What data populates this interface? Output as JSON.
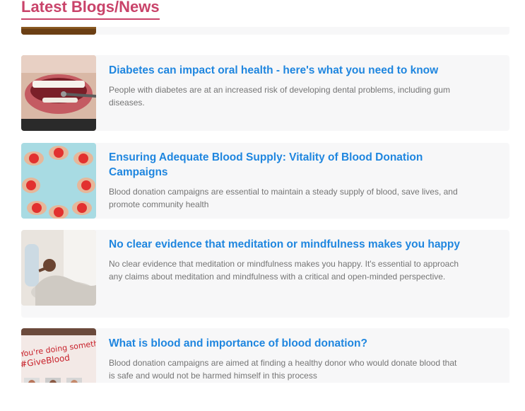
{
  "section": {
    "title": "Latest Blogs/News"
  },
  "posts": [
    {
      "title": "Diabetes can impact oral health - here's what you need to know",
      "excerpt": "People with diabetes are at an increased risk of developing dental problems, including gum diseases.",
      "image_icon": "dental-checkup-image"
    },
    {
      "title": "Ensuring Adequate Blood Supply: Vitality of Blood Donation Campaigns",
      "excerpt": "Blood donation campaigns are essential to maintain a steady supply of blood, save lives, and promote community health",
      "image_icon": "hands-holding-hearts-image"
    },
    {
      "title": "No clear evidence that meditation or mindfulness makes you happy",
      "excerpt": "No clear evidence that meditation or mindfulness makes you happy. It's essential to approach any claims about meditation and mindfulness with a critical and open-minded perspective.",
      "image_icon": "meditation-pose-image"
    },
    {
      "title": "What is blood and importance of blood donation?",
      "excerpt": "Blood donation campaigns are aimed at finding a healthy donor who would donate blood that is safe and would not be harmed himself in this process",
      "image_icon": "give-blood-banner-image",
      "image_text": [
        "You're doing something",
        "#GiveBlood"
      ]
    }
  ],
  "colors": {
    "title": "#c9436a",
    "link": "#1f86df",
    "text": "#757575",
    "card_bg": "#f7f7f8"
  }
}
